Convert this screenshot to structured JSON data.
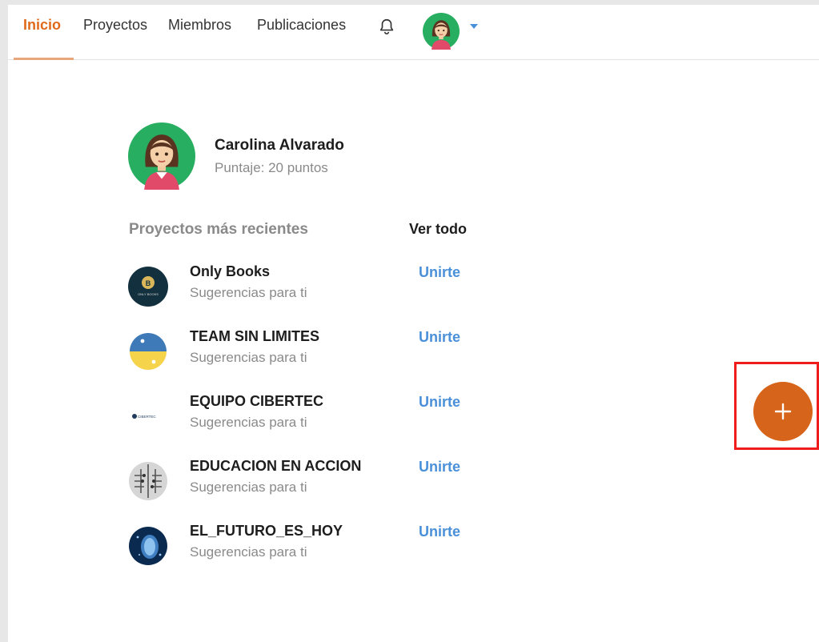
{
  "nav": {
    "items": [
      {
        "label": "Inicio",
        "active": true
      },
      {
        "label": "Proyectos",
        "active": false
      },
      {
        "label": "Miembros",
        "active": false
      },
      {
        "label": "Publicaciones",
        "active": false
      }
    ],
    "icons": {
      "notifications": "bell-icon",
      "menu": "caret-down-icon"
    }
  },
  "profile": {
    "name": "Carolina Alvarado",
    "score": "Puntaje: 20 puntos"
  },
  "projects": {
    "title": "Proyectos más recientes",
    "see_all": "Ver todo",
    "items": [
      {
        "name": "Only Books",
        "subtitle": "Sugerencias para ti",
        "action": "Unirte",
        "logo": "only-books-logo",
        "logo_text": "ONLY BOOKS"
      },
      {
        "name": "TEAM SIN LIMITES",
        "subtitle": "Sugerencias para ti",
        "action": "Unirte",
        "logo": "python-logo"
      },
      {
        "name": "EQUIPO CIBERTEC",
        "subtitle": "Sugerencias para ti",
        "action": "Unirte",
        "logo": "cibertec-logo",
        "logo_text": "CIBERTEC"
      },
      {
        "name": "EDUCACION EN ACCION",
        "subtitle": "Sugerencias para ti",
        "action": "Unirte",
        "logo": "circuit-brain-logo"
      },
      {
        "name": "EL_FUTURO_ES_HOY",
        "subtitle": "Sugerencias para ti",
        "action": "Unirte",
        "logo": "futuristic-face-logo"
      }
    ]
  },
  "fab": {
    "icon": "plus-icon"
  },
  "colors": {
    "accent": "#e06a1b",
    "link": "#4a90d9",
    "fab": "#d7641b",
    "highlight_frame": "#ef1c1c",
    "avatar_bg": "#27ae60"
  }
}
